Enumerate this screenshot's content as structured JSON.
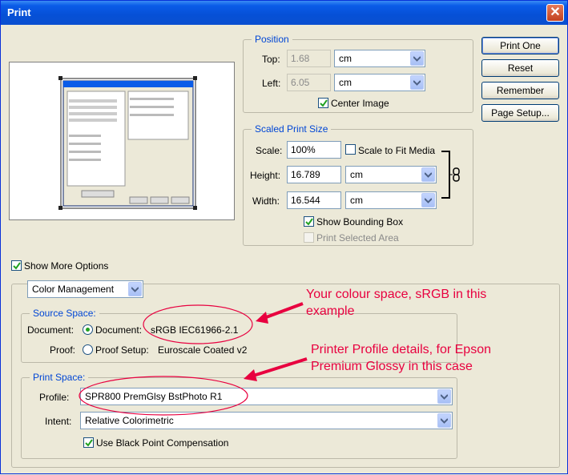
{
  "window": {
    "title": "Print"
  },
  "buttons": {
    "print_one": "Print One",
    "reset": "Reset",
    "remember": "Remember",
    "page_setup": "Page Setup..."
  },
  "position": {
    "legend": "Position",
    "top_label": "Top:",
    "top_value": "1.68",
    "top_unit": "cm",
    "left_label": "Left:",
    "left_value": "6.05",
    "left_unit": "cm",
    "center_image_label": "Center Image",
    "center_image_checked": true
  },
  "scaled": {
    "legend": "Scaled Print Size",
    "scale_label": "Scale:",
    "scale_value": "100%",
    "fit_label": "Scale to Fit Media",
    "height_label": "Height:",
    "height_value": "16.789",
    "height_unit": "cm",
    "width_label": "Width:",
    "width_value": "16.544",
    "width_unit": "cm",
    "bounding_box_label": "Show Bounding Box",
    "print_selected_label": "Print Selected Area"
  },
  "more_options": {
    "label": "Show More Options",
    "mode": "Color Management"
  },
  "source": {
    "legend": "Source Space:",
    "document_label": "Document:",
    "document_radio_label": "Document:",
    "document_value": "sRGB IEC61966-2.1",
    "proof_label": "Proof:",
    "proof_radio_label": "Proof Setup:",
    "proof_value": "Euroscale Coated v2"
  },
  "print_space": {
    "legend": "Print Space:",
    "profile_label": "Profile:",
    "profile_value": "SPR800 PremGlsy BstPhoto R1",
    "intent_label": "Intent:",
    "intent_value": "Relative Colorimetric",
    "bpc_label": "Use Black Point Compensation"
  },
  "annotations": {
    "colour_space_line1": "Your colour space, sRGB in this",
    "colour_space_line2": "example",
    "printer_profile_line1": "Printer Profile details, for Epson",
    "printer_profile_line2": "Premium Glossy in this case"
  },
  "colors": {
    "annotation": "#e8003f",
    "legend": "#0046d5",
    "title_bar": "#0a5ce8"
  }
}
